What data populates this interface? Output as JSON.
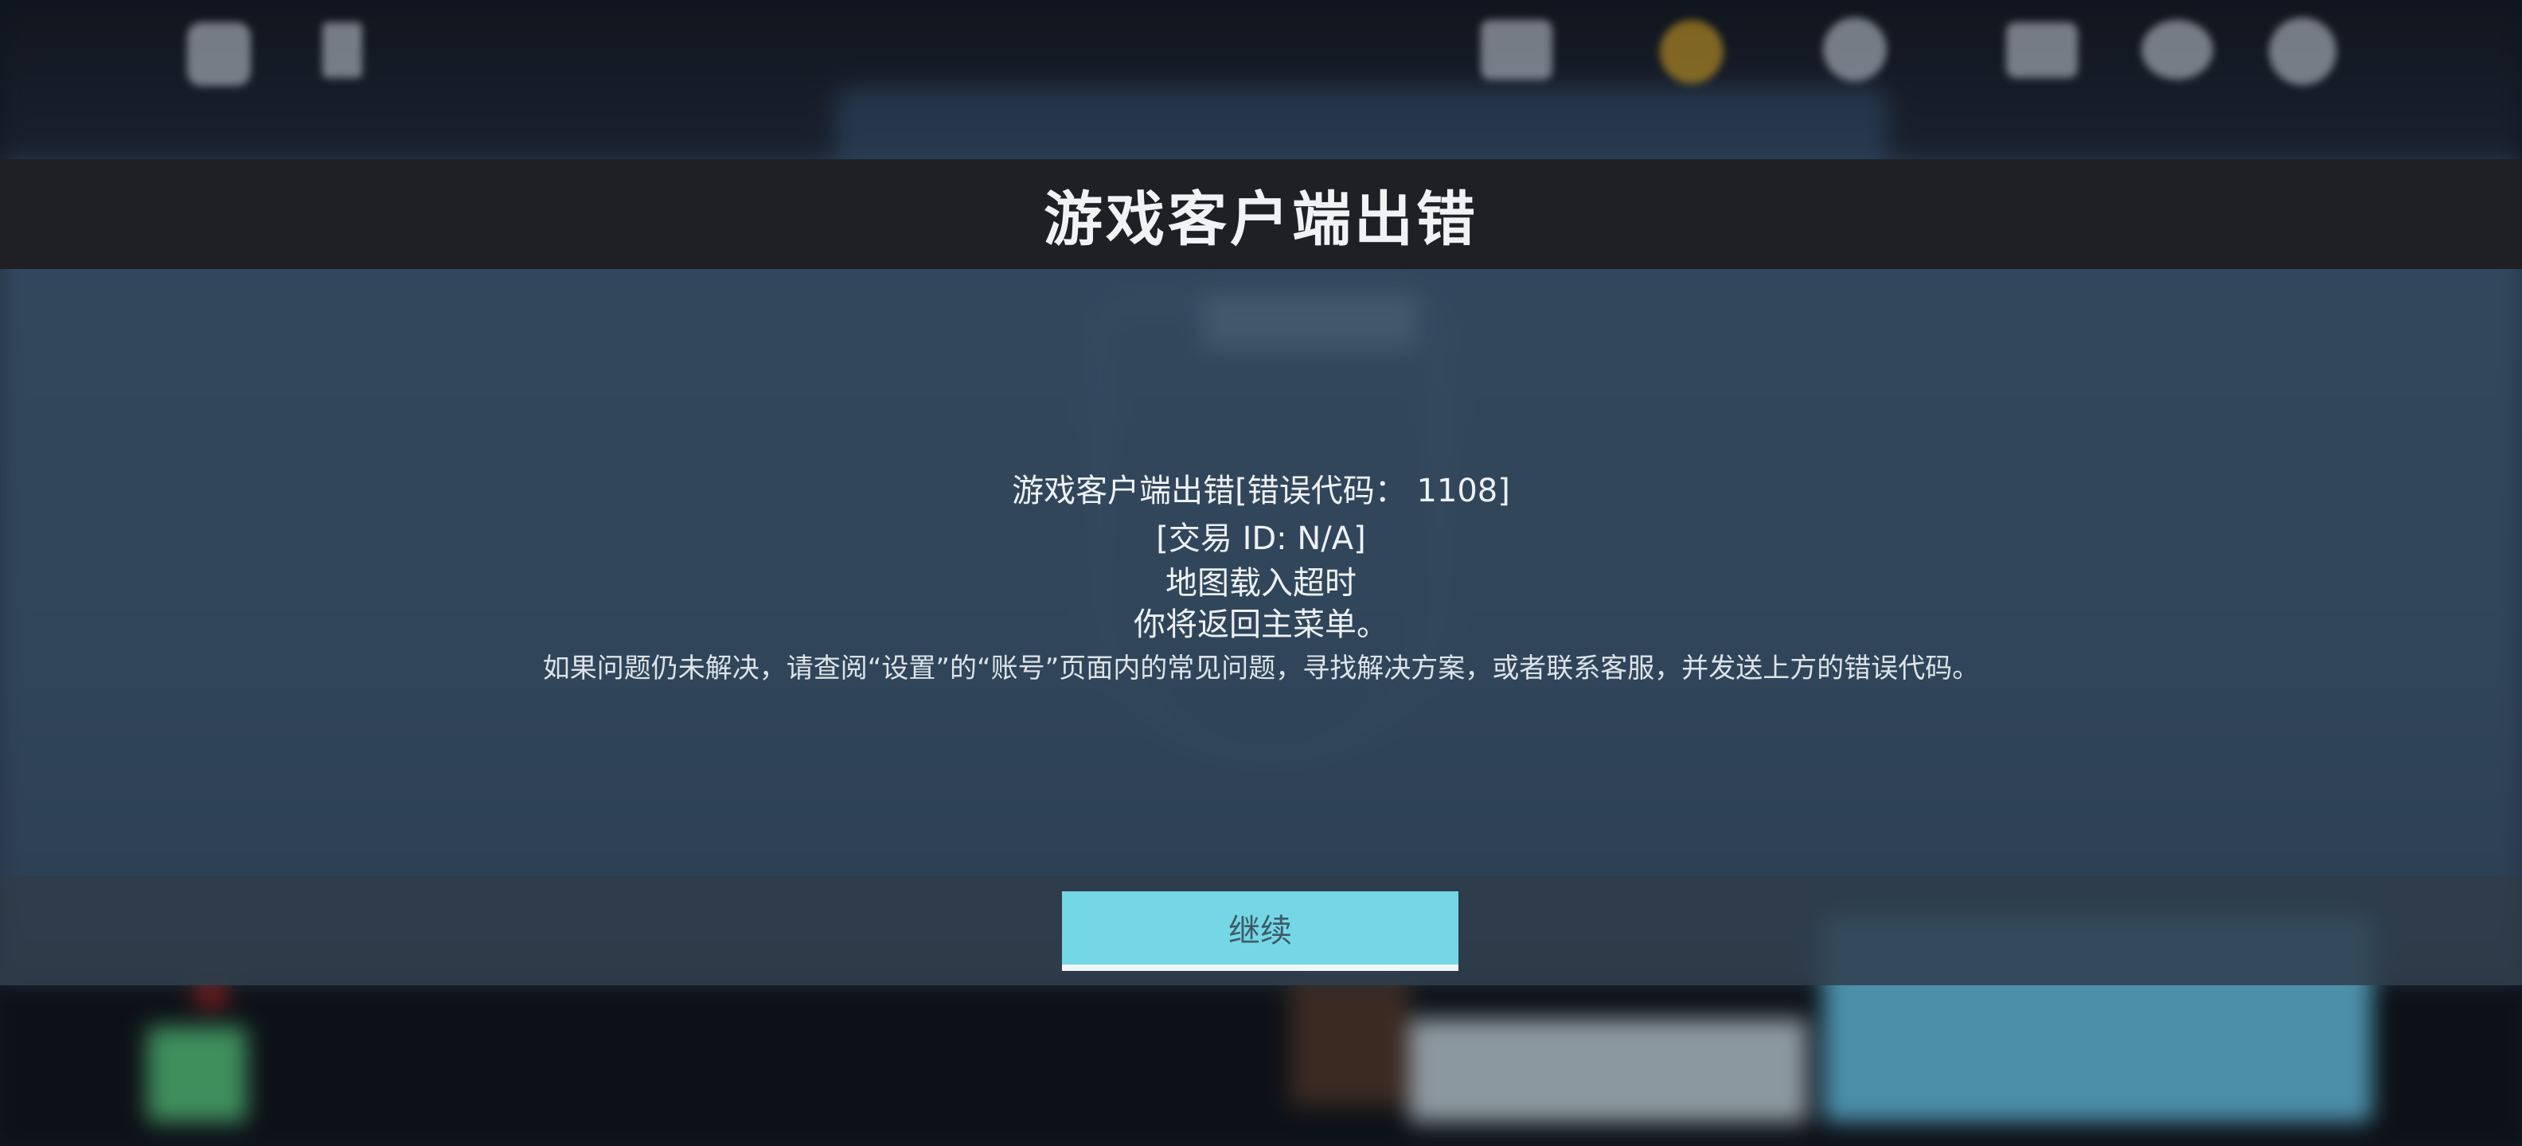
{
  "dialog": {
    "title": "游戏客户端出错",
    "lines": [
      "游戏客户端出错[错误代码： 1108]",
      "[交易 ID: N/A]",
      "地图载入超时",
      "你将返回主菜单。",
      "如果问题仍未解决，请查阅“设置”的“账号”页面内的常见问题，寻找解决方案，或者联系客服，并发送上方的错误代码。"
    ],
    "continue_label": "继续"
  },
  "icons": [
    "home-icon",
    "back-icon",
    "currency-icon",
    "coin-icon",
    "globe-icon",
    "mail-icon",
    "chat-icon",
    "settings-icon"
  ],
  "colors": {
    "title_bar": "#1e2024",
    "panel": "#344a60",
    "button": "#75d7e6",
    "button_text": "#3e5b66",
    "text": "#eef1f4"
  }
}
